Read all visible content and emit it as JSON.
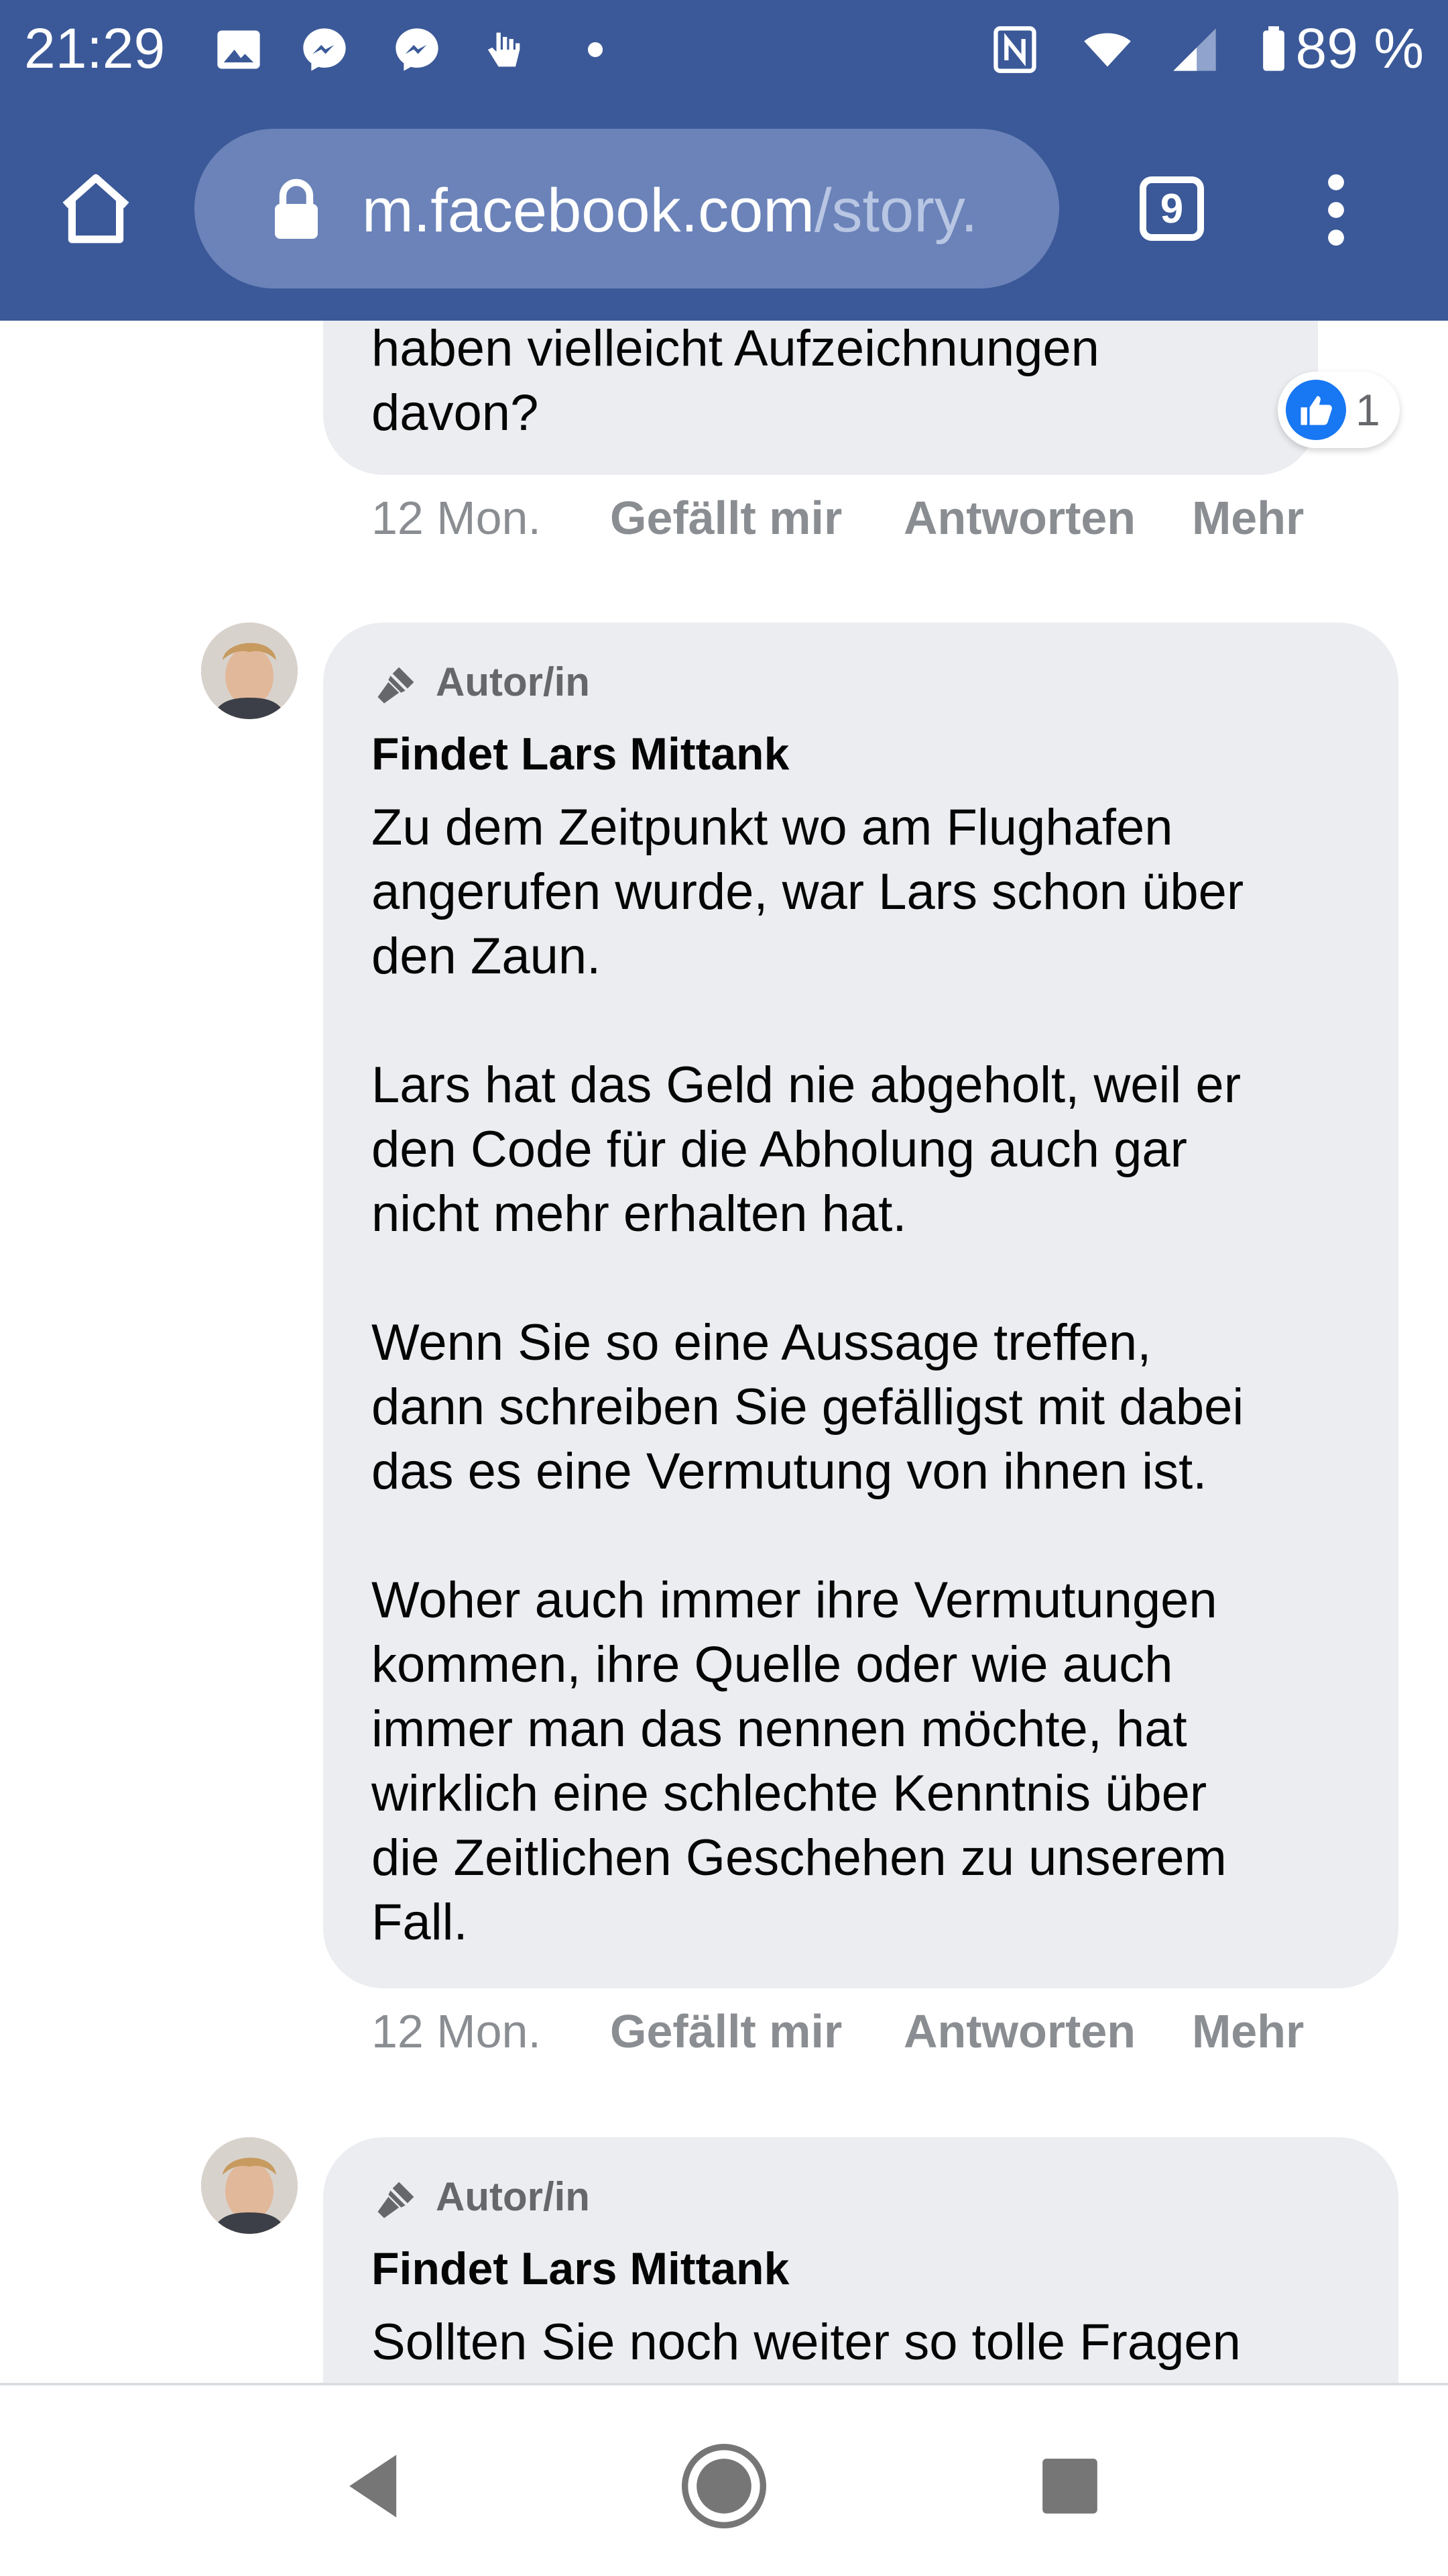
{
  "status_bar": {
    "time": "21:29",
    "battery": "89 %",
    "icons": [
      "image-icon",
      "messenger-icon",
      "messenger-icon",
      "hand-icon",
      "dot-icon",
      "nfc-icon",
      "wifi-icon",
      "signal-icon",
      "battery-icon"
    ]
  },
  "browser": {
    "url_host": "m.facebook.com",
    "url_path": "/story.",
    "tab_count": "9",
    "icons": {
      "home": "home-icon",
      "lock": "lock-icon",
      "menu": "menu-dots-icon"
    }
  },
  "colors": {
    "brand": "#3b5998",
    "bubble": "#ebedf0",
    "meta_text": "#8a8d91",
    "like_blue": "#1877f2"
  },
  "comments": [
    {
      "text": "haben vielleicht Aufzeichnungen\ndavon?",
      "reaction_count": "1",
      "time": "12 Mon.",
      "like": "Gefällt mir",
      "reply": "Antworten",
      "more": "Mehr"
    },
    {
      "badge": "Autor/in",
      "author": "Findet Lars Mittank",
      "text": "Zu dem Zeitpunkt wo am Flughafen\nangerufen wurde, war Lars schon über\nden Zaun.\n\nLars hat das Geld nie abgeholt, weil er\nden Code für die Abholung auch gar\nnicht mehr erhalten hat.\n\nWenn Sie so eine Aussage treffen,\ndann schreiben Sie gefälligst mit dabei\ndas es eine Vermutung von ihnen ist.\n\nWoher auch immer ihre Vermutungen\nkommen, ihre Quelle oder wie auch\nimmer man das nennen möchte, hat\nwirklich eine schlechte Kenntnis über\ndie Zeitlichen Geschehen zu unserem\nFall.",
      "time": "12 Mon.",
      "like": "Gefällt mir",
      "reply": "Antworten",
      "more": "Mehr"
    },
    {
      "badge": "Autor/in",
      "author": "Findet Lars Mittank",
      "text": "Sollten Sie noch weiter so tolle Fragen"
    }
  ],
  "nav_bar": {
    "buttons": [
      "back-icon",
      "home-circle-icon",
      "recents-icon"
    ]
  }
}
